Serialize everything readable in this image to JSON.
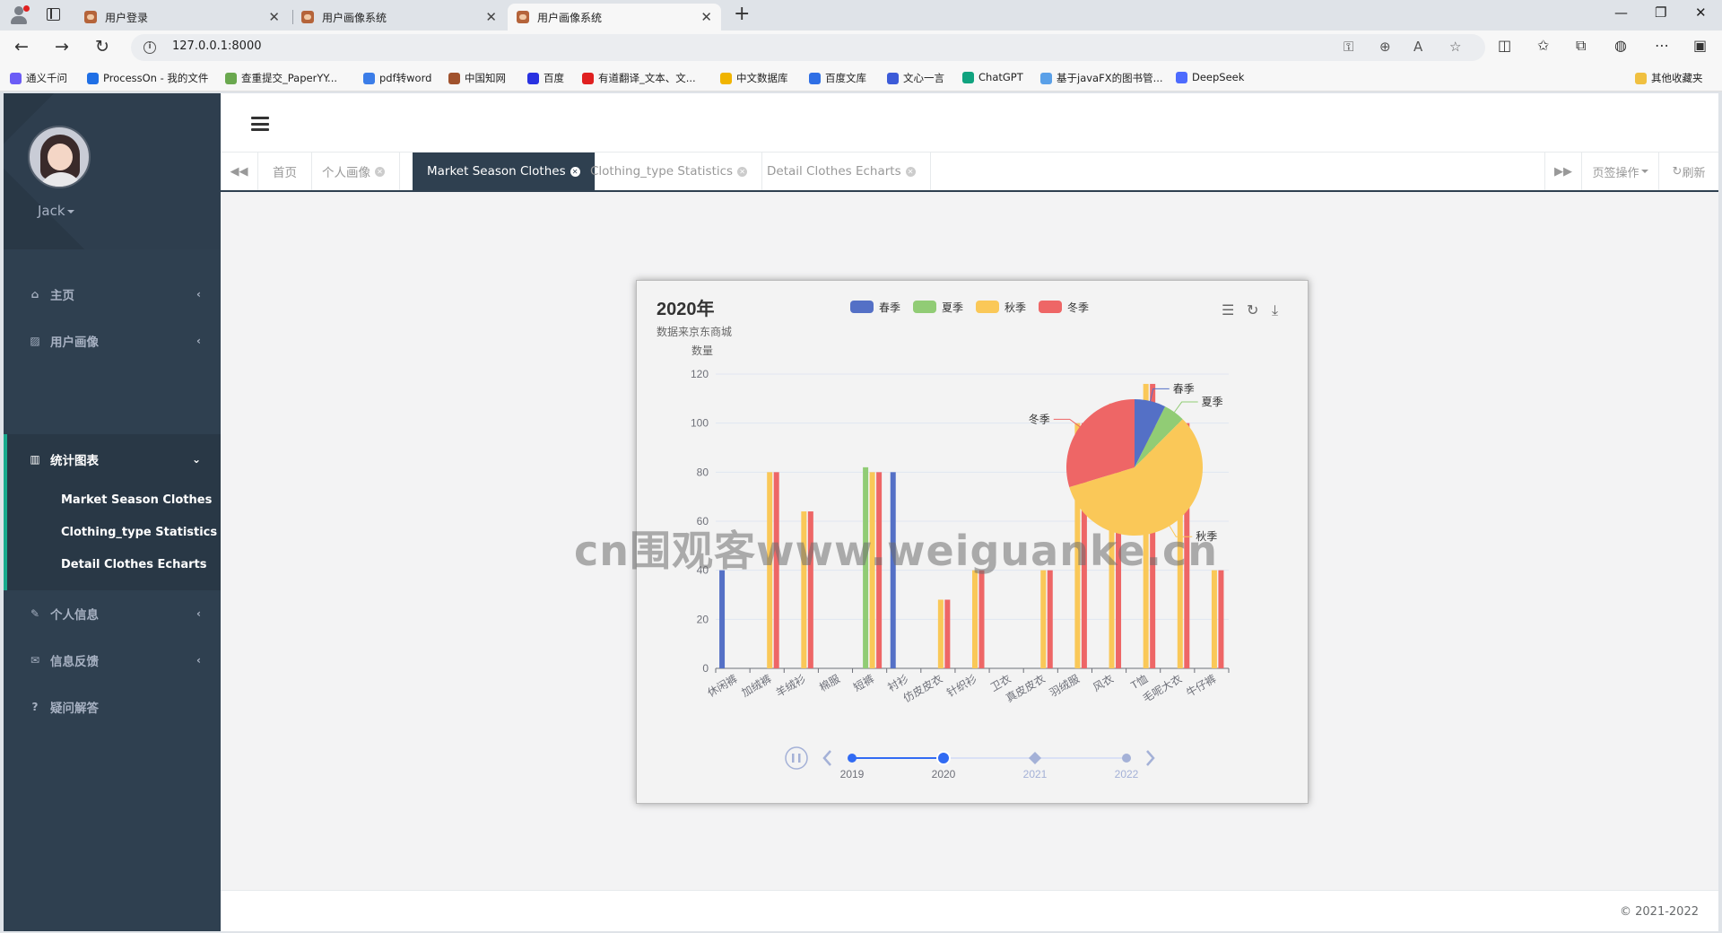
{
  "browser": {
    "tabs": [
      {
        "title": "用户登录",
        "active": false
      },
      {
        "title": "用户画像系统",
        "active": false
      },
      {
        "title": "用户画像系统",
        "active": true
      }
    ],
    "url": "127.0.0.1:8000",
    "bookmarks": [
      {
        "label": "通义千问",
        "color": "#6b5cf6"
      },
      {
        "label": "ProcessOn - 我的文件",
        "color": "#1f6fe5"
      },
      {
        "label": "查重提交_PaperYY...",
        "color": "#6aa84f"
      },
      {
        "label": "pdf转word",
        "color": "#3b7de8"
      },
      {
        "label": "中国知网",
        "color": "#a0522d"
      },
      {
        "label": "百度",
        "color": "#2932e1"
      },
      {
        "label": "有道翻译_文本、文...",
        "color": "#e02020"
      },
      {
        "label": "中文数据库",
        "color": "#f0b400"
      },
      {
        "label": "百度文库",
        "color": "#2f6fe5"
      },
      {
        "label": "文心一言",
        "color": "#3c5bd8"
      },
      {
        "label": "ChatGPT",
        "color": "#10a37f"
      },
      {
        "label": "基于javaFX的图书管...",
        "color": "#5aa0e8"
      },
      {
        "label": "DeepSeek",
        "color": "#4d6bfe"
      }
    ],
    "other_bookmarks": "其他收藏夹"
  },
  "sidebar": {
    "user": "Jack",
    "items": [
      {
        "label": "主页",
        "icon": "home-icon"
      },
      {
        "label": "用户画像",
        "icon": "picture-icon"
      },
      {
        "label": "统计图表",
        "icon": "bar-chart-icon"
      },
      {
        "label": "个人信息",
        "icon": "edit-icon"
      },
      {
        "label": "信息反馈",
        "icon": "envelope-icon"
      },
      {
        "label": "疑问解答",
        "icon": "question-icon"
      }
    ],
    "sub_items": [
      "Market Season Clothes",
      "Clothing_type Statistics",
      "Detail Clothes Echarts"
    ]
  },
  "page_tabs": {
    "items": [
      {
        "label": "首页",
        "closable": false,
        "active": false
      },
      {
        "label": "个人画像",
        "closable": true,
        "active": false
      },
      {
        "label": "Market Season Clothes",
        "closable": true,
        "active": true
      },
      {
        "label": "Clothing_type Statistics",
        "closable": true,
        "active": false
      },
      {
        "label": "Detail Clothes Echarts",
        "closable": true,
        "active": false
      }
    ],
    "tab_ops": "页签操作",
    "refresh": "刷新"
  },
  "chart_data": {
    "type": "bar",
    "title": "2020年",
    "subtitle": "数据来京东商城",
    "ylabel": "数量",
    "ylim": [
      0,
      120
    ],
    "yticks": [
      0,
      20,
      40,
      60,
      80,
      100,
      120
    ],
    "legend_position": "top-center",
    "categories": [
      "休闲裤",
      "加绒裤",
      "羊绒衫",
      "棉服",
      "短裤",
      "衬衫",
      "仿皮皮衣",
      "针织衫",
      "卫衣",
      "真皮皮衣",
      "羽绒服",
      "风衣",
      "T恤",
      "毛呢大衣",
      "牛仔裤"
    ],
    "series": [
      {
        "name": "春季",
        "color": "#5470c6",
        "values": [
          40,
          0,
          0,
          0,
          0,
          80,
          0,
          0,
          0,
          0,
          0,
          0,
          0,
          0,
          0
        ]
      },
      {
        "name": "夏季",
        "color": "#91cc75",
        "values": [
          0,
          0,
          0,
          0,
          82,
          0,
          0,
          0,
          0,
          0,
          0,
          0,
          0,
          0,
          0
        ]
      },
      {
        "name": "秋季",
        "color": "#fac858",
        "values": [
          0,
          80,
          64,
          0,
          80,
          0,
          28,
          40,
          0,
          40,
          100,
          108,
          116,
          100,
          40
        ]
      },
      {
        "name": "冬季",
        "color": "#ee6666",
        "values": [
          0,
          80,
          64,
          0,
          80,
          0,
          28,
          40,
          0,
          40,
          100,
          108,
          116,
          100,
          40
        ]
      }
    ],
    "pie": {
      "slices": [
        {
          "name": "春季",
          "value": 120,
          "color": "#5470c6"
        },
        {
          "name": "夏季",
          "value": 82,
          "color": "#91cc75"
        },
        {
          "name": "秋季",
          "value": 936,
          "color": "#fac858"
        },
        {
          "name": "冬季",
          "value": 480,
          "color": "#ee6666"
        }
      ]
    },
    "timeline": {
      "years": [
        "2019",
        "2020",
        "2021",
        "2022"
      ],
      "current": "2020"
    },
    "toolbox": [
      "data-view-icon",
      "restore-icon",
      "save-image-icon"
    ]
  },
  "watermark": "cn围观客www.weiguanke.cn",
  "footer": "© 2021-2022"
}
